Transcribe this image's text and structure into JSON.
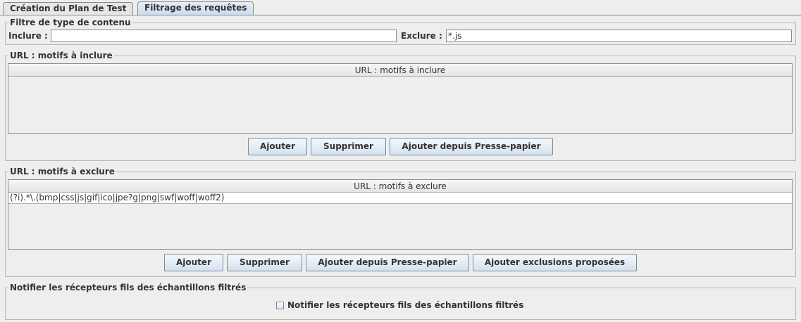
{
  "tabs": [
    {
      "label": "Création du Plan de Test"
    },
    {
      "label": "Filtrage des requêtes"
    }
  ],
  "content_filter": {
    "legend": "Filtre de type de contenu",
    "include_label": "Inclure :",
    "include_value": "",
    "exclude_label": "Exclure :",
    "exclude_value": "*.js"
  },
  "url_include": {
    "legend": "URL : motifs à inclure",
    "column_header": "URL : motifs à inclure",
    "rows": [],
    "buttons": {
      "add": "Ajouter",
      "delete": "Supprimer",
      "add_clipboard": "Ajouter depuis Presse-papier"
    }
  },
  "url_exclude": {
    "legend": "URL : motifs à exclure",
    "column_header": "URL : motifs à exclure",
    "rows": [
      "(?i).*\\.(bmp|css|js|gif|ico|jpe?g|png|swf|woff|woff2)"
    ],
    "buttons": {
      "add": "Ajouter",
      "delete": "Supprimer",
      "add_clipboard": "Ajouter depuis Presse-papier",
      "add_suggested": "Ajouter exclusions proposées"
    }
  },
  "notify": {
    "legend": "Notifier les récepteurs fils des échantillons filtrés",
    "checkbox_label": "Notifier les récepteurs fils des échantillons filtrés",
    "checked": false
  }
}
